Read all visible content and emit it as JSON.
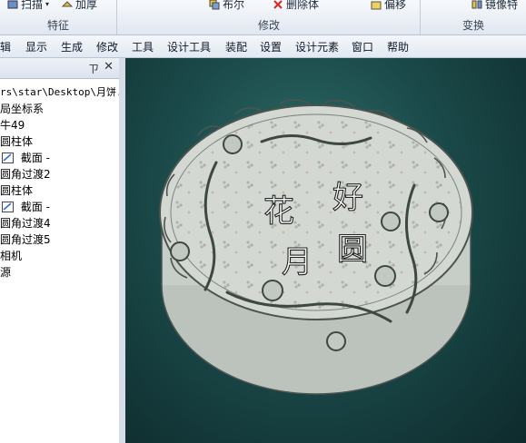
{
  "ribbon": {
    "groups": [
      {
        "label": "特征",
        "buttons": [
          {
            "label": "扫描",
            "icon": "sweep-icon"
          },
          {
            "label": "加厚",
            "icon": "thicken-icon"
          }
        ]
      },
      {
        "label": "修改",
        "buttons": [
          {
            "label": "布尔",
            "icon": "boolean-icon"
          },
          {
            "label": "删除体",
            "icon": "delete-body-icon"
          },
          {
            "label": "偏移",
            "icon": "offset-icon"
          }
        ]
      },
      {
        "label": "变换",
        "buttons": [
          {
            "label": "镜像特",
            "icon": "mirror-icon"
          }
        ]
      }
    ]
  },
  "menu": [
    "编辑",
    "显示",
    "生成",
    "修改",
    "工具",
    "设计工具",
    "装配",
    "设置",
    "设计元素",
    "窗口",
    "帮助"
  ],
  "panel": {
    "pin": "ㄗ",
    "close": "✕"
  },
  "tree": {
    "items": [
      "rs\\star\\Desktop\\月饼.i",
      "局坐标系",
      "牛49",
      "圆柱体",
      "截面 -",
      "圆角过渡2",
      "圆柱体",
      "截面 -",
      "圆角过渡4",
      "圆角过渡5",
      "相机",
      "源"
    ]
  },
  "model": {
    "characters": [
      "花",
      "好",
      "月",
      "圆"
    ],
    "colors": {
      "viewport_bg": "#1b4a4a",
      "cake": "#cfd6cf",
      "edge": "#5d655f"
    }
  }
}
